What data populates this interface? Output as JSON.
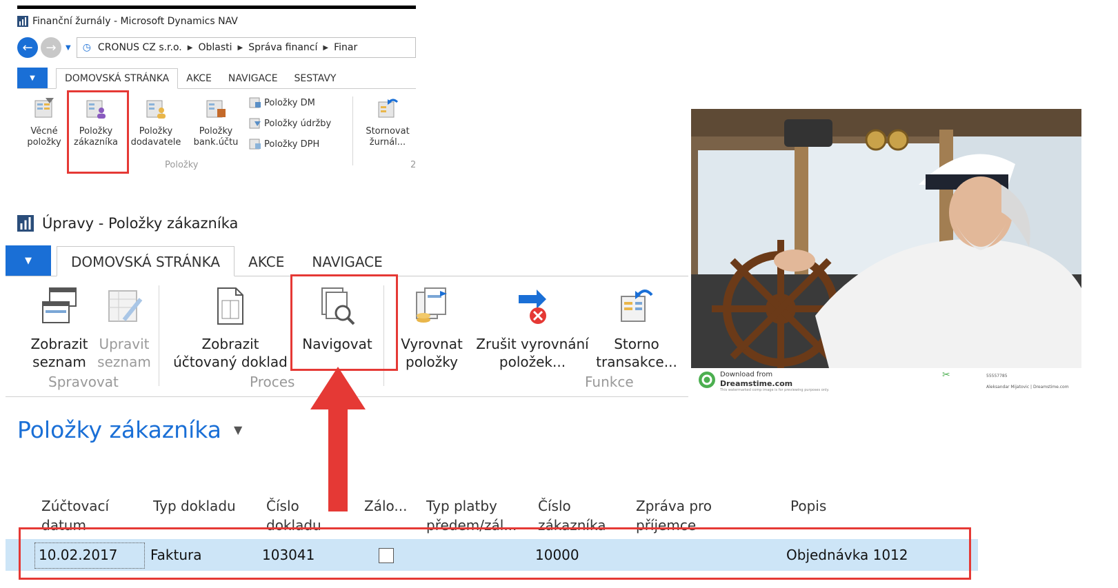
{
  "small_window": {
    "title": "Finanční žurnály - Microsoft Dynamics NAV",
    "breadcrumb": [
      "CRONUS CZ s.r.o.",
      "Oblasti",
      "Správa financí",
      "Finar"
    ],
    "tabs": [
      "DOMOVSKÁ STRÁNKA",
      "AKCE",
      "NAVIGACE",
      "SESTAVY"
    ],
    "buttons": {
      "vecne": [
        "Věcné",
        "položky"
      ],
      "zakaznika": [
        "Položky",
        "zákazníka"
      ],
      "dodavatele": [
        "Položky",
        "dodavatele"
      ],
      "bank": [
        "Položky",
        "bank.účtu"
      ],
      "stornovat": [
        "Stornovat",
        "žurnál..."
      ]
    },
    "small_rows": [
      "Položky DM",
      "Položky údržby",
      "Položky DPH"
    ],
    "group_label": "Položky",
    "group_label_trunc": "2"
  },
  "main_window": {
    "title": "Úpravy - Položky zákazníka",
    "tabs": [
      "DOMOVSKÁ STRÁNKA",
      "AKCE",
      "NAVIGACE"
    ],
    "buttons": {
      "zobrazit_seznam": [
        "Zobrazit",
        "seznam"
      ],
      "upravit_seznam": [
        "Upravit",
        "seznam"
      ],
      "zobrazit_doklad": [
        "Zobrazit",
        "účtovaný doklad"
      ],
      "navigovat": "Navigovat",
      "vyrovnat": [
        "Vyrovnat",
        "položky"
      ],
      "zrusit": [
        "Zrušit vyrovnání",
        "položek..."
      ],
      "storno": [
        "Storno",
        "transakce..."
      ]
    },
    "groups": [
      "Spravovat",
      "Proces",
      "Funkce"
    ]
  },
  "page_title": "Položky zákazníka",
  "table": {
    "headers": [
      [
        "Zúčtovací",
        "datum"
      ],
      [
        "Typ dokladu"
      ],
      [
        "Číslo",
        "dokladu"
      ],
      [
        "Zálo..."
      ],
      [
        "Typ platby",
        "předem/zál..."
      ],
      [
        "Číslo",
        "zákazníka"
      ],
      [
        "Zpráva pro",
        "příjemce"
      ],
      [
        "Popis"
      ]
    ],
    "row": {
      "date": "10.02.2017",
      "doc_type": "Faktura",
      "doc_no": "103041",
      "customer_no": "10000",
      "description": "Objednávka 1012"
    }
  },
  "photo": {
    "download_line1": "Download from",
    "download_line2": "Dreamstime.com",
    "fine_print": "This watermarked comp image is for previewing purposes only.",
    "id": "55557785",
    "credit": "Aleksandar Mijatovic | Dreamstime.com"
  },
  "colors": {
    "accent": "#1a6fd6",
    "highlight": "#e53935",
    "row_selected": "#cde5f7"
  }
}
